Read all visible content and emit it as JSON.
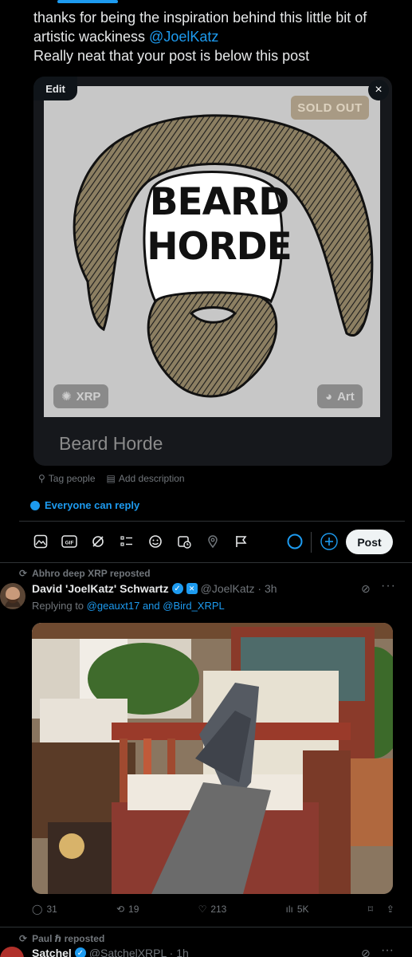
{
  "composer": {
    "text_line1": "thanks for being the inspiration behind this little bit of",
    "text_line2_prefix": "artistic wackiness ",
    "text_line2_mention": "@JoelKatz",
    "text_line3": "Really neat that your post is below this post",
    "media": {
      "edit_label": "Edit",
      "close_label": "×",
      "badge": "SOLD OUT",
      "art_title_line1": "BEARD",
      "art_title_line2": "HORDE",
      "chain_tag": "XRP",
      "category_tag": "Art",
      "card_title": "Beard Horde"
    },
    "tag_people": "Tag people",
    "add_description": "Add description",
    "reply_setting": "Everyone can reply",
    "post_button": "Post"
  },
  "post1": {
    "reposted_by": "Abhro deep XRP reposted",
    "author_name": "David 'JoelKatz' Schwartz",
    "handle_time": "@JoelKatz · 3h",
    "replying_prefix": "Replying to ",
    "replying_to": "@geauxt17 and @Bird_XRPL",
    "replies": "31",
    "reposts": "19",
    "likes": "213",
    "views": "5K"
  },
  "post2": {
    "reposted_by": "Paul ℏ reposted",
    "author_name": "Satchel",
    "handle_time": "@SatchelXRPL · 1h"
  },
  "colors": {
    "accent": "#1d9bf0",
    "background": "#000000",
    "text": "#e7e9ea",
    "muted": "#71767b"
  }
}
